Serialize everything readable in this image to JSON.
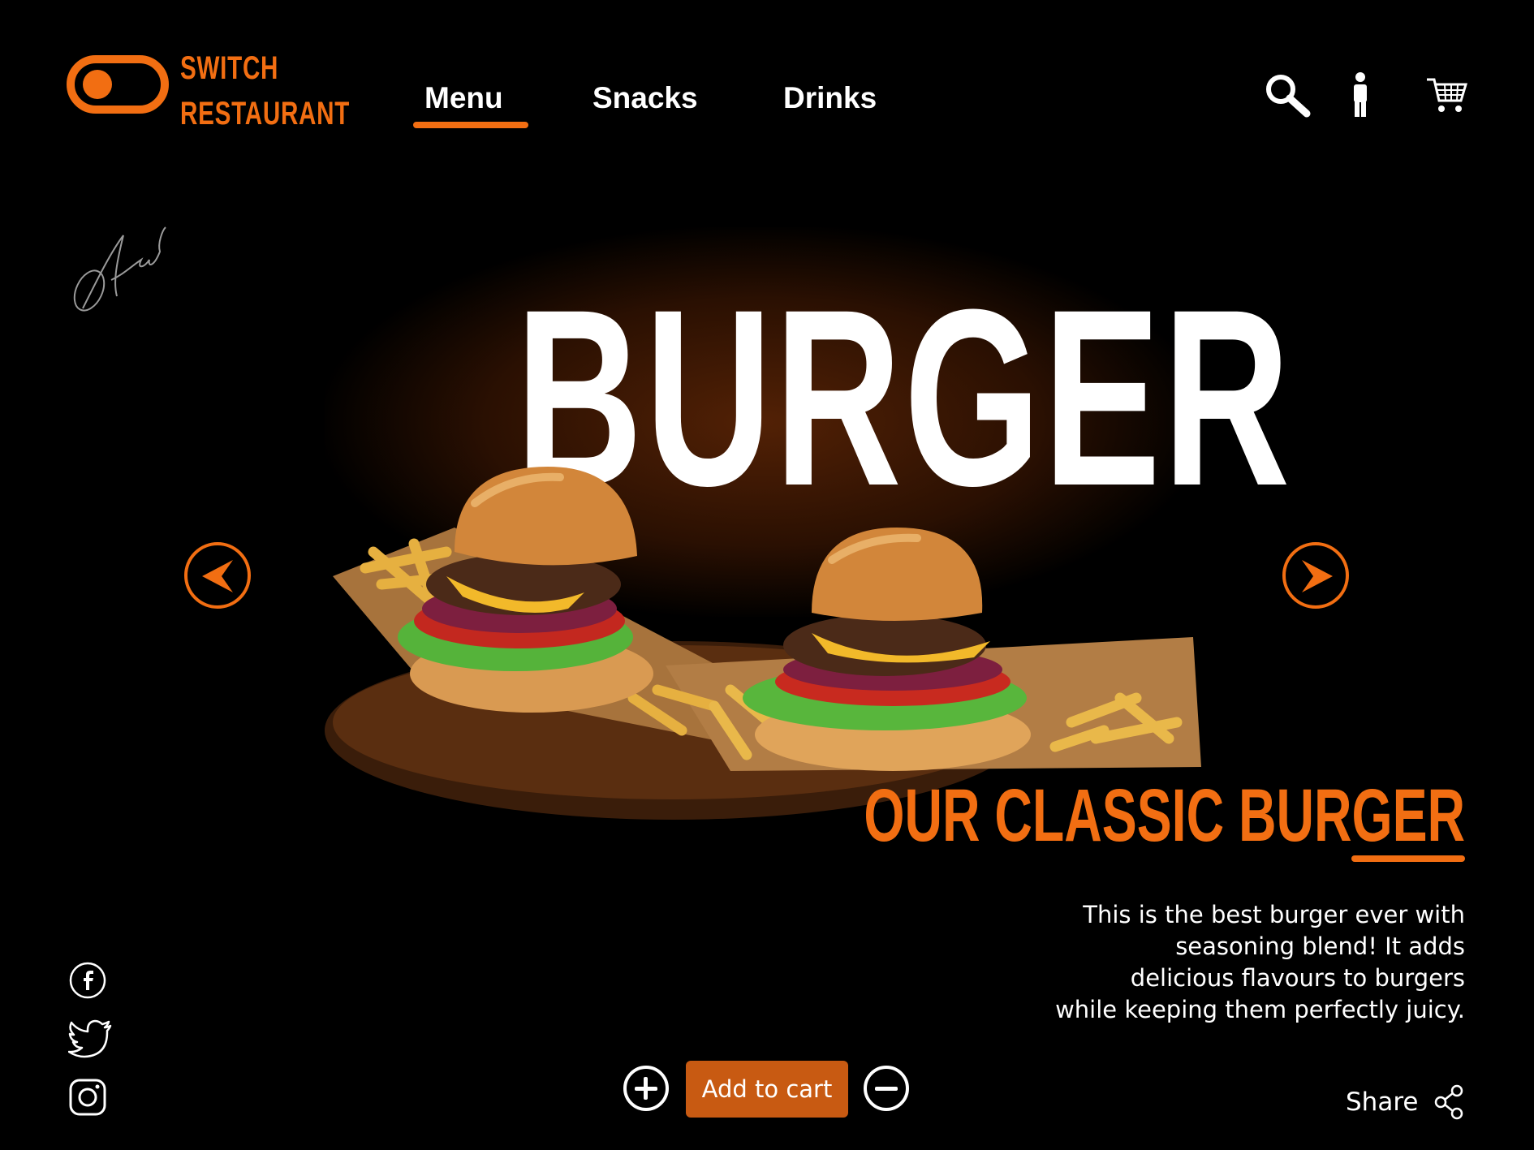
{
  "brand": {
    "name_line1": "SWITCH",
    "name_line2": "RESTAURANT",
    "accent_color": "#f26e12"
  },
  "nav": {
    "items": [
      {
        "label": "Menu",
        "active": true
      },
      {
        "label": "Snacks",
        "active": false
      },
      {
        "label": "Drinks",
        "active": false
      }
    ]
  },
  "header_icons": [
    "search-icon",
    "user-icon",
    "cart-icon"
  ],
  "hero": {
    "title": "BURGER",
    "prev_icon": "chevron-left-icon",
    "next_icon": "chevron-right-icon"
  },
  "signature": {
    "text": "Aemadel"
  },
  "product": {
    "title": "OUR CLASSIC BURGER",
    "description_lines": [
      "This is the best burger ever with",
      "seasoning blend! It adds",
      "delicious flavours to burgers",
      "while keeping them perfectly juicy."
    ]
  },
  "cart": {
    "add_label": "Add to cart",
    "button_color": "#c85a12",
    "increase_icon": "plus-icon",
    "decrease_icon": "minus-icon"
  },
  "share": {
    "label": "Share",
    "icon": "share-icon"
  },
  "social": [
    "facebook-icon",
    "twitter-icon",
    "instagram-icon"
  ]
}
